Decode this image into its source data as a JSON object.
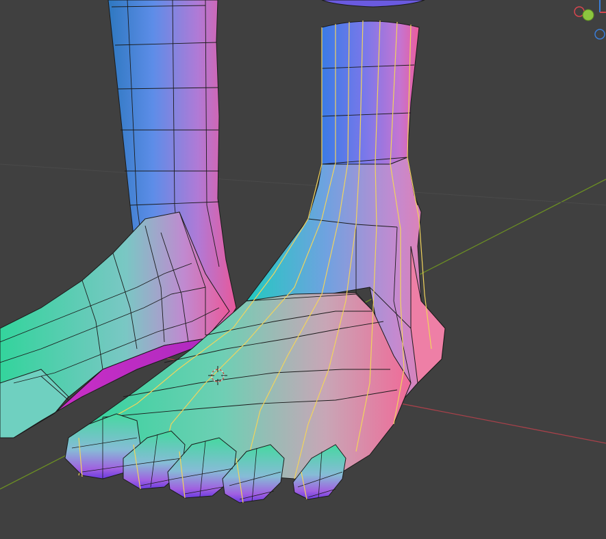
{
  "viewport": {
    "background": "#404040",
    "axis_x_color": "#a8414a",
    "axis_y_color": "#6b8e23"
  },
  "navigation_gizmo": {
    "x_axis_color": "#d9464f",
    "y_axis_color": "#8cc63f",
    "z_axis_color": "#3a7dd8"
  },
  "scene": {
    "mesh_edge_color": "#1a1a1a",
    "seam_color": "#f2d45c",
    "cursor_icon": "3d-cursor-icon"
  }
}
